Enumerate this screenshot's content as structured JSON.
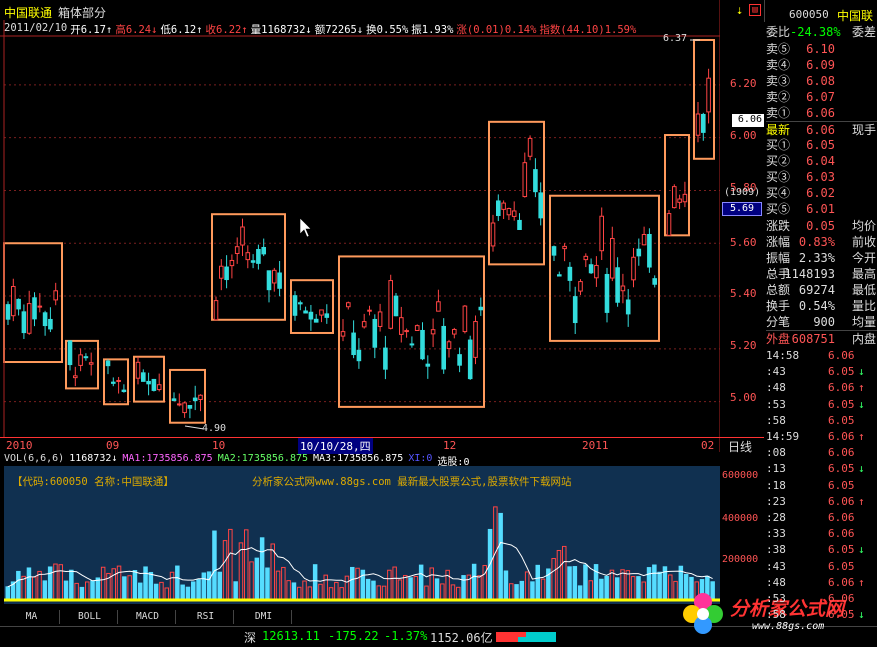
{
  "window": {
    "stock_name": "中国联通",
    "tab": "箱体部分"
  },
  "infobar": [
    {
      "t": "2011/02/10",
      "c": "#dddddd"
    },
    {
      "t": "开6.17↑",
      "c": "#ffffff"
    },
    {
      "t": "高6.24↓",
      "c": "#ff4444"
    },
    {
      "t": "低6.12↑",
      "c": "#ffffff"
    },
    {
      "t": "收6.22↑",
      "c": "#ff4444"
    },
    {
      "t": "量1168732↓",
      "c": "#ffffff"
    },
    {
      "t": "额72265↓",
      "c": "#ffffff"
    },
    {
      "t": "换0.55%",
      "c": "#ffffff"
    },
    {
      "t": "振1.93%",
      "c": "#ffffff"
    },
    {
      "t": "涨(0.01)0.14%",
      "c": "#ff4444"
    },
    {
      "t": "指数(44.10)1.59%",
      "c": "#ff4444"
    }
  ],
  "price_axis": {
    "labels": [
      "6.37",
      "6.20",
      "6.06",
      "6.00",
      "5.80",
      "5.69",
      "5.60",
      "5.40",
      "5.20",
      "5.00"
    ],
    "high_label": "6.37",
    "low_label": "4.90",
    "current_label": "6.06",
    "cursor_label": "(1909)",
    "cursor_price": "5.69"
  },
  "time_axis": {
    "labels": [
      "2010",
      "09",
      "10",
      "10/10/28,四",
      "12",
      "2011",
      "02"
    ],
    "unit": "日线"
  },
  "volume": {
    "header": [
      {
        "t": "VOL(6,6,6)",
        "c": "#dddddd"
      },
      {
        "t": "1168732↓",
        "c": "#ffffff"
      },
      {
        "t": "MA1:1735856.875",
        "c": "#ff66ff"
      },
      {
        "t": "MA2:1735856.875",
        "c": "#66ff66"
      },
      {
        "t": "MA3:1735856.875",
        "c": "#ffffff"
      },
      {
        "t": "XI:0",
        "c": "#5555ff"
      },
      {
        "t": "选股:0",
        "c": "#ffffff"
      }
    ],
    "axis": [
      "600000",
      "400000",
      "200000"
    ],
    "code_text": "【代码:600050  名称:中国联通】",
    "watermark": "分析家公式网www.88gs.com 最新最大股票公式,股票软件下载网站"
  },
  "tabs": [
    "MA",
    "BOLL",
    "MACD",
    "RSI",
    "DMI"
  ],
  "statusbar": {
    "market": "深",
    "index": "12613.11",
    "change": "-175.22",
    "pct": "-1.37%",
    "amount": "1152.06亿"
  },
  "logo": {
    "text": "分析家公式网",
    "url": "www.88gs.com"
  },
  "right_panel": {
    "code": "600050",
    "name": "中国联",
    "ratio_label": "委比",
    "ratio_value": "-24.38%",
    "ratio_extra": "委差",
    "sells": [
      {
        "l": "卖⑤",
        "v": "6.10"
      },
      {
        "l": "卖④",
        "v": "6.09"
      },
      {
        "l": "卖③",
        "v": "6.08"
      },
      {
        "l": "卖②",
        "v": "6.07"
      },
      {
        "l": "卖①",
        "v": "6.06"
      }
    ],
    "latest_label": "最新",
    "latest_value": "6.06",
    "latest_extra": "现手",
    "buys": [
      {
        "l": "买①",
        "v": "6.05"
      },
      {
        "l": "买②",
        "v": "6.04"
      },
      {
        "l": "买③",
        "v": "6.03"
      },
      {
        "l": "买④",
        "v": "6.02"
      },
      {
        "l": "买⑤",
        "v": "6.01"
      }
    ],
    "stats": [
      {
        "l": "涨跌",
        "v": "0.05",
        "e": "均价",
        "c": "#ff5555"
      },
      {
        "l": "涨幅",
        "v": "0.83%",
        "e": "前收",
        "c": "#ff5555"
      },
      {
        "l": "振幅",
        "v": "2.33%",
        "e": "今开",
        "c": "#dddddd"
      },
      {
        "l": "总手",
        "v": "1148193",
        "e": "最高",
        "c": "#dddddd"
      },
      {
        "l": "总额",
        "v": "69274",
        "e": "最低",
        "c": "#dddddd"
      },
      {
        "l": "换手",
        "v": "0.54%",
        "e": "量比",
        "c": "#dddddd"
      },
      {
        "l": "分笔",
        "v": "900",
        "e": "均量",
        "c": "#dddddd"
      }
    ],
    "outer_label": "外盘",
    "outer_value": "608751",
    "inner_label": "内盘",
    "ticks": [
      {
        "t": "14:58",
        "p": "6.06",
        "a": ""
      },
      {
        "t": ":43",
        "p": "6.05",
        "a": "↓"
      },
      {
        "t": ":48",
        "p": "6.06",
        "a": "↑"
      },
      {
        "t": ":53",
        "p": "6.05",
        "a": "↓"
      },
      {
        "t": ":58",
        "p": "6.05",
        "a": ""
      },
      {
        "t": "14:59",
        "p": "6.06",
        "a": "↑"
      },
      {
        "t": ":08",
        "p": "6.06",
        "a": ""
      },
      {
        "t": ":13",
        "p": "6.05",
        "a": "↓"
      },
      {
        "t": ":18",
        "p": "6.05",
        "a": ""
      },
      {
        "t": ":23",
        "p": "6.06",
        "a": "↑"
      },
      {
        "t": ":28",
        "p": "6.06",
        "a": ""
      },
      {
        "t": ":33",
        "p": "6.06",
        "a": ""
      },
      {
        "t": ":38",
        "p": "6.05",
        "a": "↓"
      },
      {
        "t": ":43",
        "p": "6.05",
        "a": ""
      },
      {
        "t": ":48",
        "p": "6.06",
        "a": "↑"
      },
      {
        "t": ":53",
        "p": "6.06",
        "a": ""
      },
      {
        "t": ":58",
        "p": "6.05",
        "a": "↓"
      }
    ]
  },
  "chart_data": {
    "type": "candlestick",
    "price_range": [
      4.9,
      6.37
    ],
    "boxes": [
      {
        "low": 5.15,
        "high": 5.6
      },
      {
        "low": 5.05,
        "high": 5.23
      },
      {
        "low": 4.99,
        "high": 5.16
      },
      {
        "low": 5.0,
        "high": 5.17
      },
      {
        "low": 4.92,
        "high": 5.12
      },
      {
        "low": 5.31,
        "high": 5.71
      },
      {
        "low": 5.26,
        "high": 5.46
      },
      {
        "low": 4.98,
        "high": 5.55
      },
      {
        "low": 5.52,
        "high": 6.06
      },
      {
        "low": 5.23,
        "high": 5.78
      },
      {
        "low": 5.63,
        "high": 6.01
      },
      {
        "low": 5.92,
        "high": 6.37
      }
    ]
  }
}
